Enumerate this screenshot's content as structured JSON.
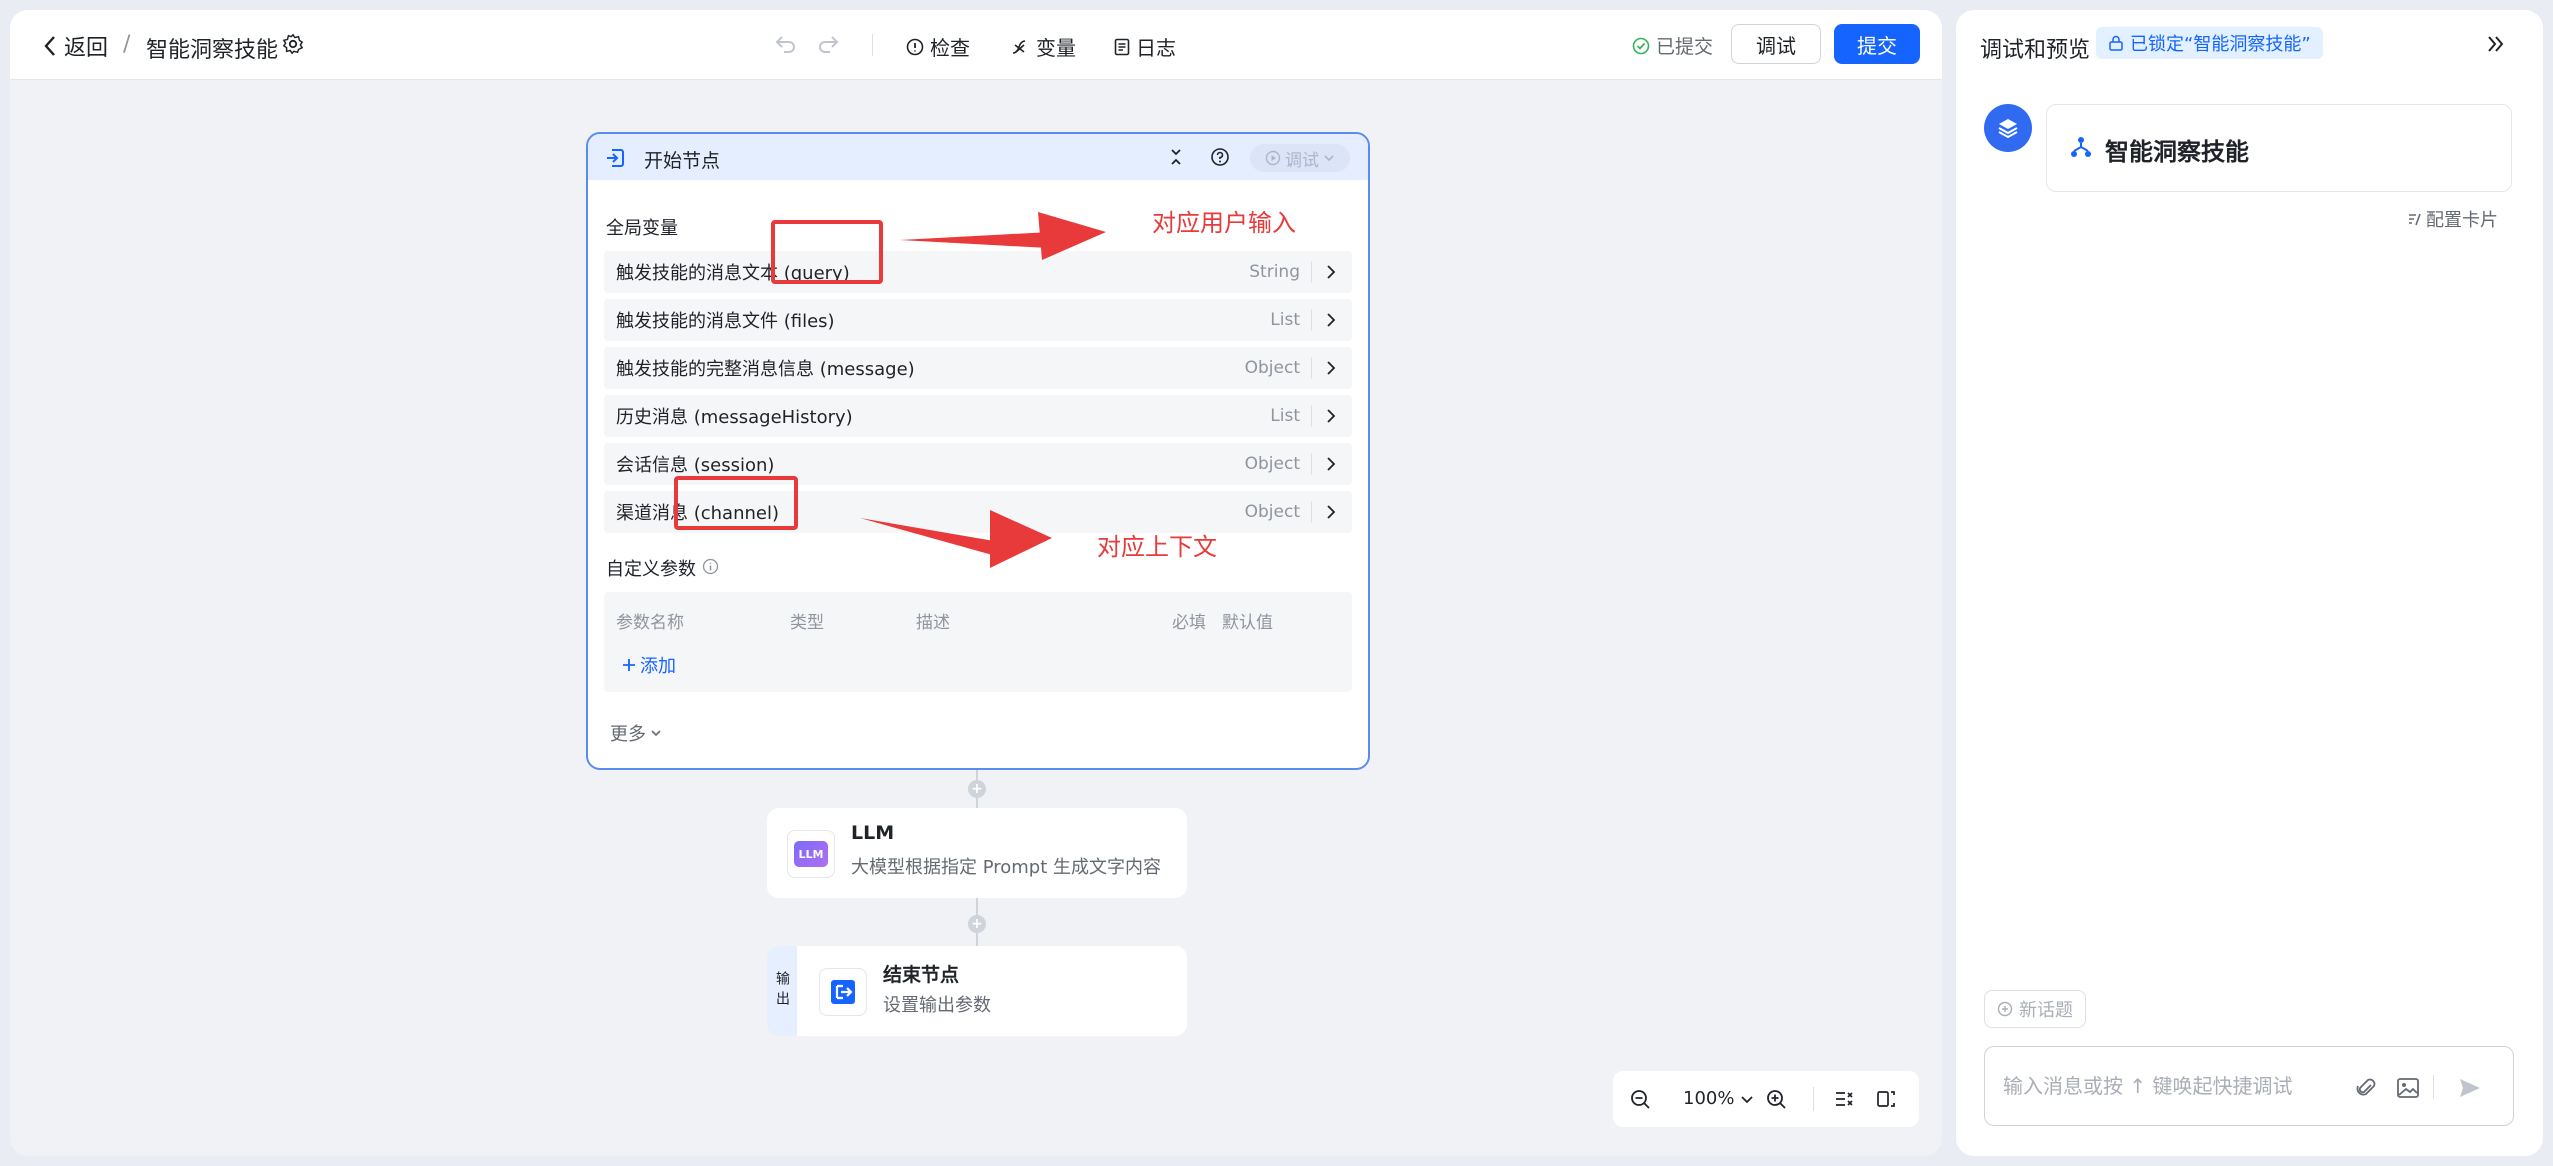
{
  "topbar": {
    "back_label": "返回",
    "separator": "/",
    "skill_name": "智能洞察技能",
    "check_label": "检查",
    "variables_label": "变量",
    "logs_label": "日志",
    "submitted_status": "已提交",
    "debug_button": "调试",
    "submit_button": "提交",
    "accent_color": "#1664ff"
  },
  "start_node": {
    "title": "开始节点",
    "debug_label": "调试",
    "global_vars_label": "全局变量",
    "variables": [
      {
        "name": "触发技能的消息文本 (query)",
        "type": "String"
      },
      {
        "name": "触发技能的消息文件 (files)",
        "type": "List"
      },
      {
        "name": "触发技能的完整消息信息 (message)",
        "type": "Object"
      },
      {
        "name": "历史消息 (messageHistory)",
        "type": "List"
      },
      {
        "name": "会话信息 (session)",
        "type": "Object"
      },
      {
        "name": "渠道消息 (channel)",
        "type": "Object"
      }
    ],
    "custom_params_label": "自定义参数",
    "param_headers": [
      "参数名称",
      "类型",
      "描述",
      "必填",
      "默认值"
    ],
    "add_label": "添加",
    "more_label": "更多"
  },
  "llm_node": {
    "badge": "LLM",
    "title": "LLM",
    "description": "大模型根据指定 Prompt 生成文字内容"
  },
  "end_node": {
    "output_tag": "输出",
    "title": "结束节点",
    "description": "设置输出参数"
  },
  "zoom": {
    "level": "100%"
  },
  "annotations": {
    "user_input": "对应用户输入",
    "context": "对应上下文",
    "color": "#e83a3a"
  },
  "side_panel": {
    "title": "调试和预览",
    "lock_badge": "已锁定“智能洞察技能”",
    "card_title": "智能洞察技能",
    "config_card": "配置卡片",
    "new_topic": "新话题",
    "input_placeholder": "输入消息或按 ↑ 键唤起快捷调试"
  }
}
